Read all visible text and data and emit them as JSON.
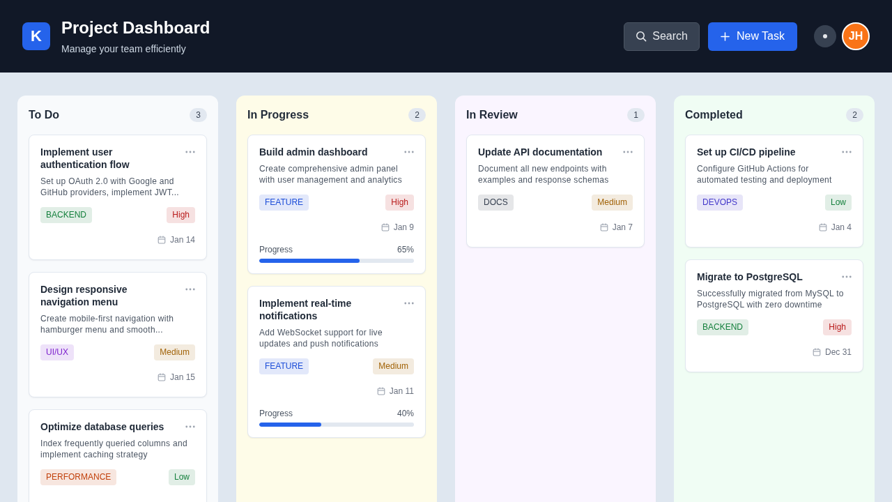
{
  "header": {
    "logo": "K",
    "title": "Project Dashboard",
    "subtitle": "Manage your team efficiently",
    "search_button": "Search",
    "new_task_button": "New Task",
    "avatar": "JH"
  },
  "columns": [
    {
      "title": "To Do",
      "count": "3",
      "color": "#f8fafc",
      "cards": [
        {
          "title": "Implement user authentication flow",
          "description": "Set up OAuth 2.0 with Google and GitHub providers, implement JWT...",
          "tag": {
            "label": "BACKEND",
            "color": "#15803d"
          },
          "priority": {
            "label": "High",
            "color": "#b91c1c"
          },
          "due": "Jan 14"
        },
        {
          "title": "Design responsive navigation menu",
          "description": "Create mobile-first navigation with hamburger menu and smooth...",
          "tag": {
            "label": "UI/UX",
            "color": "#7e22ce"
          },
          "priority": {
            "label": "Medium",
            "color": "#a16207"
          },
          "due": "Jan 15"
        },
        {
          "title": "Optimize database queries",
          "description": "Index frequently queried columns and implement caching strategy",
          "tag": {
            "label": "PERFORMANCE",
            "color": "#c2410c"
          },
          "priority": {
            "label": "Low",
            "color": "#15803d"
          }
        }
      ]
    },
    {
      "title": "In Progress",
      "count": "2",
      "color": "#fefce8",
      "cards": [
        {
          "title": "Build admin dashboard",
          "description": "Create comprehensive admin panel with user management and analytics",
          "tag": {
            "label": "FEATURE",
            "color": "#1d4ed8"
          },
          "priority": {
            "label": "High",
            "color": "#b91c1c"
          },
          "due": "Jan 9",
          "progress": {
            "label": "Progress",
            "reading": "65%",
            "level": 0.65
          }
        },
        {
          "title": "Implement real-time notifications",
          "description": "Add WebSocket support for live updates and push notifications",
          "tag": {
            "label": "FEATURE",
            "color": "#1d4ed8"
          },
          "priority": {
            "label": "Medium",
            "color": "#a16207"
          },
          "due": "Jan 11",
          "progress": {
            "label": "Progress",
            "reading": "40%",
            "level": 0.4
          }
        }
      ]
    },
    {
      "title": "In Review",
      "count": "1",
      "color": "#faf5ff",
      "cards": [
        {
          "title": "Update API documentation",
          "description": "Document all new endpoints with examples and response schemas",
          "tag": {
            "label": "DOCS",
            "color": "#374151"
          },
          "priority": {
            "label": "Medium",
            "color": "#a16207"
          },
          "due": "Jan 7"
        }
      ]
    },
    {
      "title": "Completed",
      "count": "2",
      "color": "#f0fdf4",
      "cards": [
        {
          "title": "Set up CI/CD pipeline",
          "description": "Configure GitHub Actions for automated testing and deployment",
          "tag": {
            "label": "DEVOPS",
            "color": "#4338ca"
          },
          "priority": {
            "label": "Low",
            "color": "#15803d"
          },
          "due": "Jan 4"
        },
        {
          "title": "Migrate to PostgreSQL",
          "description": "Successfully migrated from MySQL to PostgreSQL with zero downtime",
          "tag": {
            "label": "BACKEND",
            "color": "#15803d"
          },
          "priority": {
            "label": "High",
            "color": "#b91c1c"
          },
          "due": "Dec 31"
        }
      ]
    }
  ]
}
